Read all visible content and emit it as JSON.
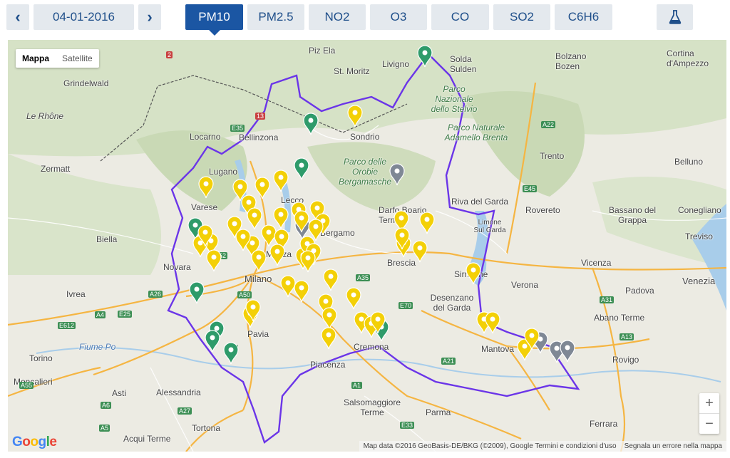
{
  "toolbar": {
    "prev_icon": "chevron-left-icon",
    "date": "04-01-2016",
    "next_icon": "chevron-right-icon",
    "pollutants": [
      "PM10",
      "PM2.5",
      "NO2",
      "O3",
      "CO",
      "SO2",
      "C6H6"
    ],
    "active": "PM10",
    "tool_icon": "flask-icon"
  },
  "map": {
    "map_types": [
      "Mappa",
      "Satellite"
    ],
    "selected_type": "Mappa",
    "places": [
      "Grindelwald",
      "Piz Ela",
      "St. Moritz",
      "Livigno",
      "Solda Sulden",
      "Bolzano Bozen",
      "Cortina d'Ampezzo",
      "Le Rhône",
      "Locarno",
      "Bellinzona",
      "Sondrio",
      "Zermatt",
      "Trento",
      "Belluno",
      "Lugano",
      "Varese",
      "Lecco",
      "Darfo Boario Terme",
      "Riva del Garda",
      "Rovereto",
      "Bassano del Grappa",
      "Conegliano",
      "Limone Sul Garda",
      "Bergamo",
      "Treviso",
      "Biella",
      "Monza",
      "Brescia",
      "Vicenza",
      "Novara",
      "Milano",
      "Sirmione",
      "Verona",
      "Venezia",
      "Ivrea",
      "Desenzano del Garda",
      "Padova",
      "Abano Terme",
      "Pavia",
      "Cremona",
      "Mantova",
      "Torino",
      "Fiume Po",
      "Piacenza",
      "Rovigo",
      "Moncalieri",
      "Asti",
      "Alessandria",
      "Salsomaggiore Terme",
      "Parma",
      "Tortona",
      "Ferrara",
      "Acqui Terme"
    ],
    "parks": [
      "Parco Nazionale dello Stelvio",
      "Parco Naturale Adamello Brenta",
      "Parco delle Orobie Bergamasche"
    ],
    "roads": [
      "2",
      "E35",
      "13",
      "A22",
      "E45",
      "E62",
      "A35",
      "E70",
      "A4",
      "A26",
      "A50",
      "E25",
      "A1",
      "A13",
      "A31",
      "A7",
      "E612",
      "A55",
      "A21",
      "A6",
      "E33",
      "A27",
      "A5"
    ],
    "marker_levels": [
      "good",
      "moderate",
      "no-data"
    ],
    "marker_colors": {
      "good": "#2e9b6a",
      "moderate": "#f3d007",
      "no-data": "#7f8895"
    },
    "boundary_color": "#6b35e8",
    "zoom_in": "+",
    "zoom_out": "−",
    "google_logo": "Google",
    "attribution": "Map data ©2016 GeoBasis-DE/BKG (©2009), Google  Termini e condizioni d'uso",
    "report_link": "Segnala un errore nella mappa"
  }
}
